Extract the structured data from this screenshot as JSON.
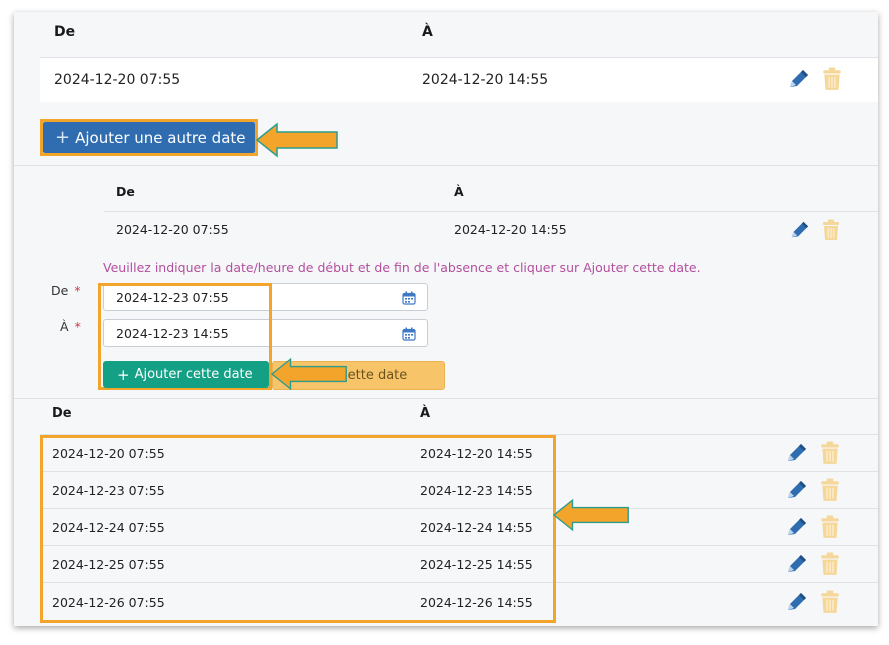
{
  "top_table": {
    "headers": {
      "from": "De",
      "to": "À"
    },
    "rows": [
      {
        "from": "2024-12-20 07:55",
        "to": "2024-12-20 14:55"
      }
    ]
  },
  "add_another_button": {
    "label": "Ajouter une autre date"
  },
  "nested_table": {
    "headers": {
      "from": "De",
      "to": "À"
    },
    "rows": [
      {
        "from": "2024-12-20 07:55",
        "to": "2024-12-20 14:55"
      }
    ]
  },
  "form": {
    "hint": "Veuillez indiquer la date/heure de début et de fin de l'absence et cliquer sur Ajouter cette date.",
    "from_label": "De",
    "to_label": "À",
    "required_mark": "*",
    "from_value": "2024-12-23 07:55",
    "to_value": "2024-12-23 14:55",
    "add_button_label": "Ajouter cette date",
    "second_button_visible_text": "er cette date"
  },
  "bottom_table": {
    "headers": {
      "from": "De",
      "to": "À"
    },
    "rows": [
      {
        "from": "2024-12-20 07:55",
        "to": "2024-12-20 14:55"
      },
      {
        "from": "2024-12-23 07:55",
        "to": "2024-12-23 14:55"
      },
      {
        "from": "2024-12-24 07:55",
        "to": "2024-12-24 14:55"
      },
      {
        "from": "2024-12-25 07:55",
        "to": "2024-12-25 14:55"
      },
      {
        "from": "2024-12-26 07:55",
        "to": "2024-12-26 14:55"
      }
    ]
  },
  "icons": {
    "edit": "pencil-icon",
    "delete": "trash-icon",
    "calendar": "calendar-icon",
    "plus": "plus-icon",
    "arrow": "arrow-left-callout"
  },
  "colors": {
    "highlight": "#f2a52a",
    "primary": "#2f6db0",
    "success": "#14a085",
    "warning": "#f7c46a",
    "hint": "#b34f9d",
    "edit": "#2f6db0",
    "delete": "#f5d79a"
  }
}
